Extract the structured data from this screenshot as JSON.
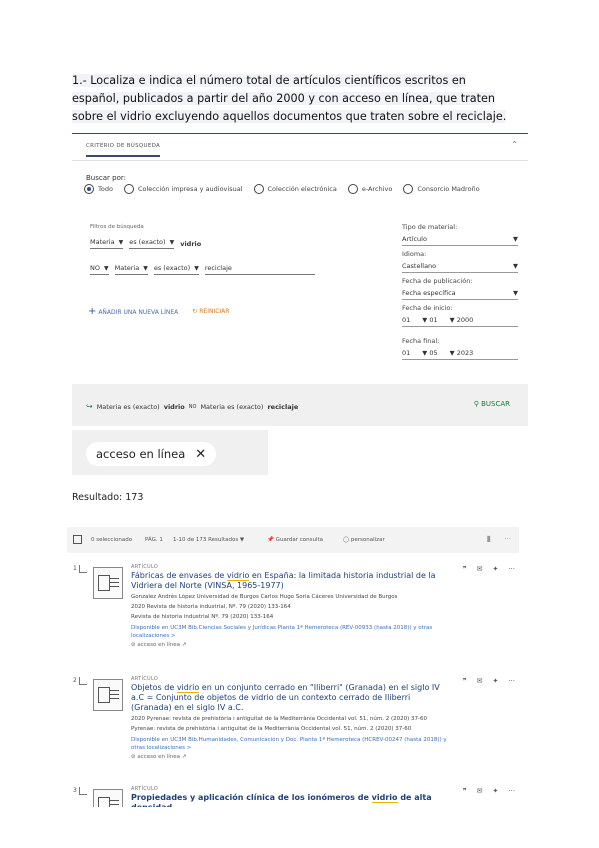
{
  "question": {
    "text": "1.- Localiza e indica el número total de artículos científicos escritos en español, publicados a partir del año 2000 y con acceso en línea, que traten sobre el vidrio excluyendo aquellos documentos que traten sobre el reciclaje."
  },
  "panel": {
    "header_label": "CRITERIO DE BÚSQUEDA",
    "buscar_por": "Buscar por:",
    "radios": [
      "Todo",
      "Colección impresa y audiovisual",
      "Colección electrónica",
      "e-Archivo",
      "Consorcio Madroño"
    ],
    "filter_label": "Filtros de búsqueda",
    "row1": {
      "field": "Materia",
      "op": "es (exacto)",
      "value": "vidrio"
    },
    "row2": {
      "bool": "NO",
      "field": "Materia",
      "op": "es (exacto)",
      "value": "reciclaje"
    },
    "add_label": "AÑADIR UNA NUEVA LÍNEA",
    "reset_label": "REINICIAR",
    "right": {
      "tipo_label": "Tipo de material:",
      "tipo_value": "Artículo",
      "idioma_label": "Idioma:",
      "idioma_value": "Castellano",
      "fecha_label": "Fecha de publicación:",
      "fecha_value": "Fecha específica",
      "inicio_label": "Fecha de inicio:",
      "inicio_d": "01",
      "inicio_m": "01",
      "inicio_y": "2000",
      "final_label": "Fecha final:",
      "final_d": "01",
      "final_m": "05",
      "final_y": "2023"
    },
    "summary": {
      "part1": "Materia es (exacto)",
      "part2": "vidrio",
      "part3": "NO",
      "part4": "Materia es (exacto)",
      "part5": "reciclaje"
    },
    "search_button": "BUSCAR"
  },
  "chip": {
    "label": "acceso en línea",
    "close": "✕"
  },
  "resultado": "Resultado: 173",
  "toolbar": {
    "selected": "0 seleccionado",
    "page": "PÁG. 1",
    "range": "1-10 de 173 Resultados",
    "save": "Guardar consulta",
    "personalize": "personalizar"
  },
  "results": [
    {
      "num": "1",
      "type": "ARTÍCULO",
      "title_a": "Fábricas de envases de ",
      "title_hl": "vidrio",
      "title_b": " en España: la limitada historia industrial de la Vidriera del Norte (VINSA, 1965-1977)",
      "meta1": "Gonzalez Andrés López Universidad de Burgos Carlos Hugo Soria Cáceres Universidad de Burgos",
      "meta2": "2020 Revista de historia industrial, Nº. 79 (2020) 133-164",
      "meta3": "Revista de historia industrial Nº. 79 (2020) 133-164",
      "avail": "Disponible en UC3M Bib.Ciencias Sociales y Jurídicas Planta 1ª Hemeroteca (REV-00933 (hasta 2018)) y otras localizaciones >",
      "access": "acceso en línea"
    },
    {
      "num": "2",
      "type": "ARTÍCULO",
      "title_a": "Objetos de ",
      "title_hl": "vidrio",
      "title_b": " en un conjunto cerrado en \"Iliberri\" (Granada) en el siglo IV a.C = Conjunto de objetos de vidrio de un contexto cerrado de Iliberri (Granada) en el siglo IV a.C.",
      "meta1": "2020 Pyrenae: revista de prehistòria i antiguitat de la Mediterrània Occidental vol. 51, núm. 2 (2020) 37-60",
      "meta2": "Pyrenae: revista de prehistòria i antiguitat de la Mediterrània Occidental vol. 51, núm. 2 (2020) 37-60",
      "meta3": "",
      "avail": "Disponible en UC3M Bib.Humanidades, Comunicación y Doc. Planta 1ª Hemeroteca (HCREV-00247 (hasta 2018)) y otras localizaciones >",
      "access": "acceso en línea"
    },
    {
      "num": "3",
      "type": "ARTÍCULO",
      "title_a": "Propiedades y aplicación clínica de los ionómeros de ",
      "title_hl": "vidrio",
      "title_b": " de alta densidad",
      "meta1": "",
      "meta2": "",
      "meta3": "",
      "avail": "",
      "access": ""
    }
  ]
}
